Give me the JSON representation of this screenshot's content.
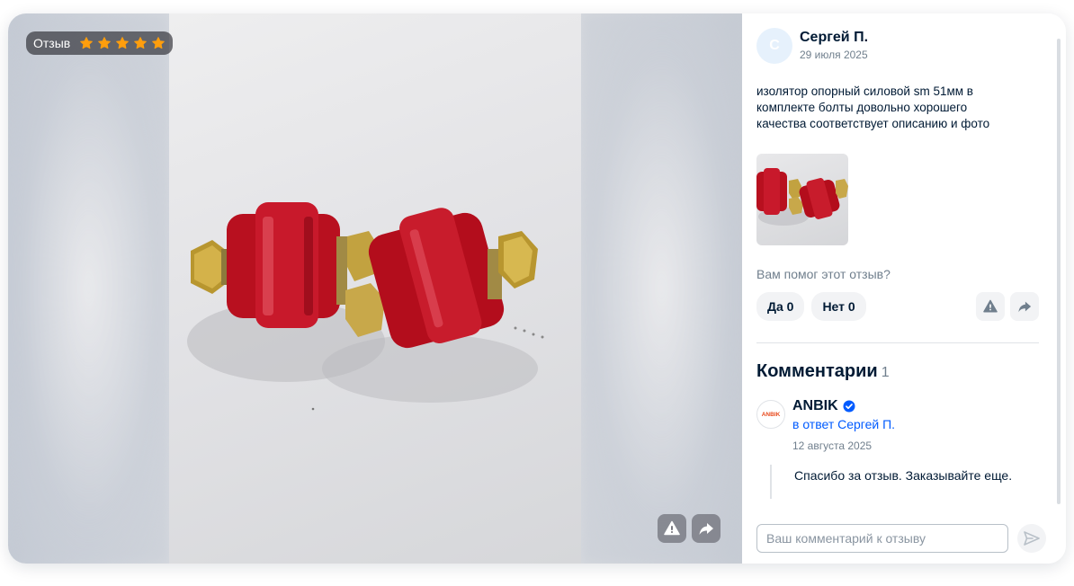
{
  "media": {
    "badge_label": "Отзыв",
    "stars": 5,
    "star_color": "#ff9e0d"
  },
  "review": {
    "author_initial": "С",
    "author_name": "Сергей П.",
    "date": "29 июля 2025",
    "text": "изолятор опорный силовой sm 51мм в комплекте болты довольно хорошего качества соответствует описанию и фото",
    "helpful_question": "Вам помог этот отзыв?",
    "yes_label": "Да 0",
    "no_label": "Нет 0"
  },
  "comments": {
    "title": "Комментарии",
    "count": "1",
    "items": [
      {
        "logo_text": "ANBIK",
        "author": "ANBIK",
        "reply_to": "в ответ Сергей П.",
        "date": "12 августа 2025",
        "text": "Спасибо за отзыв. Заказывайте еще."
      }
    ],
    "input_placeholder": "Ваш комментарий к отзыву"
  },
  "colors": {
    "accent_blue": "#005bff",
    "insulator_red": "#c8102e",
    "text_dark": "#001a34",
    "text_muted": "#707f8d"
  }
}
